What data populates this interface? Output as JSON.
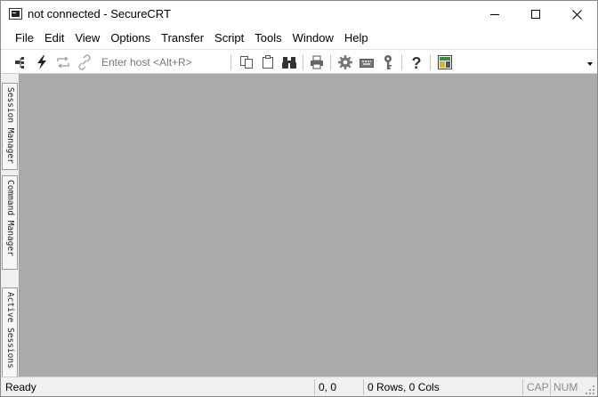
{
  "window": {
    "title": "not connected - SecureCRT",
    "app_icon": "securecrt-terminal-icon",
    "controls": [
      "minimize-icon",
      "maximize-icon",
      "close-icon"
    ]
  },
  "menu": {
    "items": [
      "File",
      "Edit",
      "View",
      "Options",
      "Transfer",
      "Script",
      "Tools",
      "Window",
      "Help"
    ]
  },
  "toolbar": {
    "host_placeholder": "Enter host <Alt+R>",
    "icons": [
      "connect-in-tab-icon",
      "quick-connect-lightning-icon",
      "reconnect-icon",
      "disconnect-icon",
      "copy-icon",
      "paste-icon",
      "find-binoculars-icon",
      "print-icon",
      "session-options-gear-icon",
      "keymap-keyboard-icon",
      "public-key-icon",
      "help-question-icon",
      "sftp-icon",
      "toolbar-chevron-icon"
    ]
  },
  "side_tabs": [
    "Session Manager",
    "Command Manager",
    "Active Sessions"
  ],
  "status": {
    "ready": "Ready",
    "position": "0, 0",
    "size": "0 Rows, 0 Cols",
    "cap": "CAP",
    "num": "NUM"
  },
  "colors": {
    "workspace": "#ababab",
    "chrome": "#f0f0f0",
    "title_bar": "#ffffff",
    "disabled_text": "#8a8a8a"
  }
}
